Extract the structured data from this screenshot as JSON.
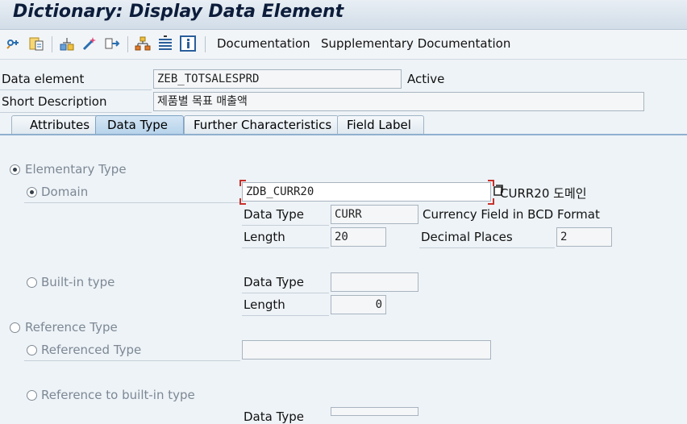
{
  "window": {
    "title": "Dictionary: Display Data Element"
  },
  "toolbar": {
    "icons": [
      "other-object-icon",
      "display-change-icon",
      "where-used-icon",
      "activate-icon",
      "navigate-icon",
      "hierarchy-icon",
      "stack-icon",
      "info-icon"
    ],
    "documentation_label": "Documentation",
    "supplementary_label": "Supplementary Documentation"
  },
  "header": {
    "data_element_label": "Data element",
    "data_element_value": "ZEB_TOTSALESPRD",
    "status": "Active",
    "short_desc_label": "Short Description",
    "short_desc_value": "제품별 목표 매출액"
  },
  "tabs": [
    {
      "label": "Attributes",
      "active": false
    },
    {
      "label": "Data Type",
      "active": true
    },
    {
      "label": "Further Characteristics",
      "active": false
    },
    {
      "label": "Field Label",
      "active": false
    }
  ],
  "data_type_tab": {
    "elementary_type_label": "Elementary Type",
    "domain_label": "Domain",
    "domain_value": "ZDB_CURR20",
    "domain_desc": "CURR20 도메인",
    "domain_data_type_label": "Data Type",
    "domain_data_type_value": "CURR",
    "domain_data_type_desc": "Currency Field in BCD Format",
    "domain_length_label": "Length",
    "domain_length_value": "20",
    "decimal_places_label": "Decimal Places",
    "decimal_places_value": "2",
    "builtin_label": "Built-in type",
    "builtin_data_type_label": "Data Type",
    "builtin_data_type_value": "",
    "builtin_length_label": "Length",
    "builtin_length_value": "0",
    "reference_type_label": "Reference Type",
    "referenced_type_label": "Referenced Type",
    "referenced_type_value": "",
    "ref_builtin_label": "Reference to built-in type",
    "ref_builtin_data_type_label": "Data Type"
  },
  "colors": {
    "accent": "#8fb0cf",
    "title_text": "#0c1c3a",
    "disabled_text": "#7c8894"
  }
}
